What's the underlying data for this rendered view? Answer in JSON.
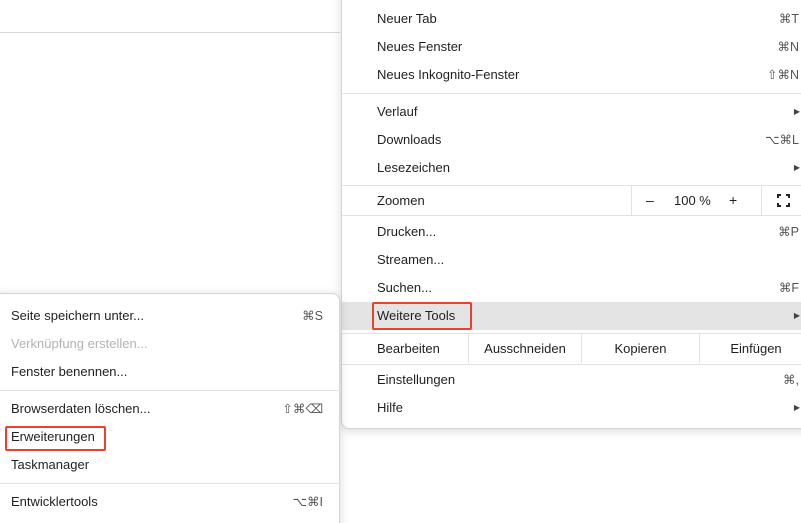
{
  "main_menu": {
    "new_tab": {
      "label": "Neuer Tab",
      "shortcut": "⌘T"
    },
    "new_window": {
      "label": "Neues Fenster",
      "shortcut": "⌘N"
    },
    "new_incognito": {
      "label": "Neues Inkognito-Fenster",
      "shortcut": "⇧⌘N"
    },
    "history": {
      "label": "Verlauf"
    },
    "downloads": {
      "label": "Downloads",
      "shortcut": "⌥⌘L"
    },
    "bookmarks": {
      "label": "Lesezeichen"
    },
    "zoom": {
      "label": "Zoomen",
      "minus": "–",
      "value": "100 %",
      "plus": "+"
    },
    "print": {
      "label": "Drucken...",
      "shortcut": "⌘P"
    },
    "cast": {
      "label": "Streamen..."
    },
    "find": {
      "label": "Suchen...",
      "shortcut": "⌘F"
    },
    "more_tools": {
      "label": "Weitere Tools"
    },
    "edit": {
      "label": "Bearbeiten",
      "cut": "Ausschneiden",
      "copy": "Kopieren",
      "paste": "Einfügen"
    },
    "settings": {
      "label": "Einstellungen",
      "shortcut": "⌘,"
    },
    "help": {
      "label": "Hilfe"
    },
    "arrow_glyph": "▶"
  },
  "sub_menu": {
    "save_page": {
      "label": "Seite speichern unter...",
      "shortcut": "⌘S"
    },
    "create_shortcut": {
      "label": "Verknüpfung erstellen...",
      "disabled": true
    },
    "name_window": {
      "label": "Fenster benennen..."
    },
    "clear_data": {
      "label": "Browserdaten löschen...",
      "shortcut": "⇧⌘⌫"
    },
    "extensions": {
      "label": "Erweiterungen"
    },
    "task_manager": {
      "label": "Taskmanager"
    },
    "dev_tools": {
      "label": "Entwicklertools",
      "shortcut": "⌥⌘I"
    }
  },
  "colors": {
    "highlight_outline": "#e8412c",
    "hover_background": "#e4e4e4"
  }
}
